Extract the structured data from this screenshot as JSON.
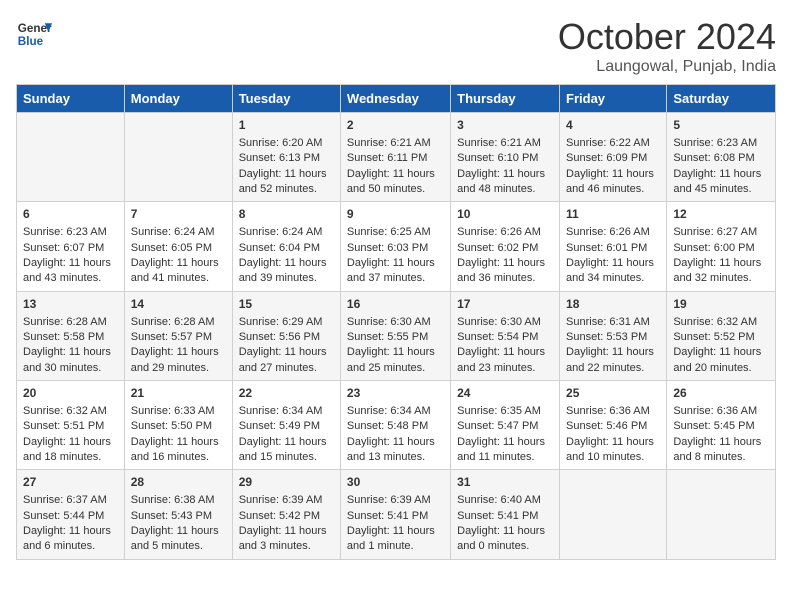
{
  "header": {
    "logo_line1": "General",
    "logo_line2": "Blue",
    "month": "October 2024",
    "location": "Laungowal, Punjab, India"
  },
  "days_of_week": [
    "Sunday",
    "Monday",
    "Tuesday",
    "Wednesday",
    "Thursday",
    "Friday",
    "Saturday"
  ],
  "weeks": [
    [
      {
        "day": "",
        "sunrise": "",
        "sunset": "",
        "daylight": ""
      },
      {
        "day": "",
        "sunrise": "",
        "sunset": "",
        "daylight": ""
      },
      {
        "day": "1",
        "sunrise": "Sunrise: 6:20 AM",
        "sunset": "Sunset: 6:13 PM",
        "daylight": "Daylight: 11 hours and 52 minutes."
      },
      {
        "day": "2",
        "sunrise": "Sunrise: 6:21 AM",
        "sunset": "Sunset: 6:11 PM",
        "daylight": "Daylight: 11 hours and 50 minutes."
      },
      {
        "day": "3",
        "sunrise": "Sunrise: 6:21 AM",
        "sunset": "Sunset: 6:10 PM",
        "daylight": "Daylight: 11 hours and 48 minutes."
      },
      {
        "day": "4",
        "sunrise": "Sunrise: 6:22 AM",
        "sunset": "Sunset: 6:09 PM",
        "daylight": "Daylight: 11 hours and 46 minutes."
      },
      {
        "day": "5",
        "sunrise": "Sunrise: 6:23 AM",
        "sunset": "Sunset: 6:08 PM",
        "daylight": "Daylight: 11 hours and 45 minutes."
      }
    ],
    [
      {
        "day": "6",
        "sunrise": "Sunrise: 6:23 AM",
        "sunset": "Sunset: 6:07 PM",
        "daylight": "Daylight: 11 hours and 43 minutes."
      },
      {
        "day": "7",
        "sunrise": "Sunrise: 6:24 AM",
        "sunset": "Sunset: 6:05 PM",
        "daylight": "Daylight: 11 hours and 41 minutes."
      },
      {
        "day": "8",
        "sunrise": "Sunrise: 6:24 AM",
        "sunset": "Sunset: 6:04 PM",
        "daylight": "Daylight: 11 hours and 39 minutes."
      },
      {
        "day": "9",
        "sunrise": "Sunrise: 6:25 AM",
        "sunset": "Sunset: 6:03 PM",
        "daylight": "Daylight: 11 hours and 37 minutes."
      },
      {
        "day": "10",
        "sunrise": "Sunrise: 6:26 AM",
        "sunset": "Sunset: 6:02 PM",
        "daylight": "Daylight: 11 hours and 36 minutes."
      },
      {
        "day": "11",
        "sunrise": "Sunrise: 6:26 AM",
        "sunset": "Sunset: 6:01 PM",
        "daylight": "Daylight: 11 hours and 34 minutes."
      },
      {
        "day": "12",
        "sunrise": "Sunrise: 6:27 AM",
        "sunset": "Sunset: 6:00 PM",
        "daylight": "Daylight: 11 hours and 32 minutes."
      }
    ],
    [
      {
        "day": "13",
        "sunrise": "Sunrise: 6:28 AM",
        "sunset": "Sunset: 5:58 PM",
        "daylight": "Daylight: 11 hours and 30 minutes."
      },
      {
        "day": "14",
        "sunrise": "Sunrise: 6:28 AM",
        "sunset": "Sunset: 5:57 PM",
        "daylight": "Daylight: 11 hours and 29 minutes."
      },
      {
        "day": "15",
        "sunrise": "Sunrise: 6:29 AM",
        "sunset": "Sunset: 5:56 PM",
        "daylight": "Daylight: 11 hours and 27 minutes."
      },
      {
        "day": "16",
        "sunrise": "Sunrise: 6:30 AM",
        "sunset": "Sunset: 5:55 PM",
        "daylight": "Daylight: 11 hours and 25 minutes."
      },
      {
        "day": "17",
        "sunrise": "Sunrise: 6:30 AM",
        "sunset": "Sunset: 5:54 PM",
        "daylight": "Daylight: 11 hours and 23 minutes."
      },
      {
        "day": "18",
        "sunrise": "Sunrise: 6:31 AM",
        "sunset": "Sunset: 5:53 PM",
        "daylight": "Daylight: 11 hours and 22 minutes."
      },
      {
        "day": "19",
        "sunrise": "Sunrise: 6:32 AM",
        "sunset": "Sunset: 5:52 PM",
        "daylight": "Daylight: 11 hours and 20 minutes."
      }
    ],
    [
      {
        "day": "20",
        "sunrise": "Sunrise: 6:32 AM",
        "sunset": "Sunset: 5:51 PM",
        "daylight": "Daylight: 11 hours and 18 minutes."
      },
      {
        "day": "21",
        "sunrise": "Sunrise: 6:33 AM",
        "sunset": "Sunset: 5:50 PM",
        "daylight": "Daylight: 11 hours and 16 minutes."
      },
      {
        "day": "22",
        "sunrise": "Sunrise: 6:34 AM",
        "sunset": "Sunset: 5:49 PM",
        "daylight": "Daylight: 11 hours and 15 minutes."
      },
      {
        "day": "23",
        "sunrise": "Sunrise: 6:34 AM",
        "sunset": "Sunset: 5:48 PM",
        "daylight": "Daylight: 11 hours and 13 minutes."
      },
      {
        "day": "24",
        "sunrise": "Sunrise: 6:35 AM",
        "sunset": "Sunset: 5:47 PM",
        "daylight": "Daylight: 11 hours and 11 minutes."
      },
      {
        "day": "25",
        "sunrise": "Sunrise: 6:36 AM",
        "sunset": "Sunset: 5:46 PM",
        "daylight": "Daylight: 11 hours and 10 minutes."
      },
      {
        "day": "26",
        "sunrise": "Sunrise: 6:36 AM",
        "sunset": "Sunset: 5:45 PM",
        "daylight": "Daylight: 11 hours and 8 minutes."
      }
    ],
    [
      {
        "day": "27",
        "sunrise": "Sunrise: 6:37 AM",
        "sunset": "Sunset: 5:44 PM",
        "daylight": "Daylight: 11 hours and 6 minutes."
      },
      {
        "day": "28",
        "sunrise": "Sunrise: 6:38 AM",
        "sunset": "Sunset: 5:43 PM",
        "daylight": "Daylight: 11 hours and 5 minutes."
      },
      {
        "day": "29",
        "sunrise": "Sunrise: 6:39 AM",
        "sunset": "Sunset: 5:42 PM",
        "daylight": "Daylight: 11 hours and 3 minutes."
      },
      {
        "day": "30",
        "sunrise": "Sunrise: 6:39 AM",
        "sunset": "Sunset: 5:41 PM",
        "daylight": "Daylight: 11 hours and 1 minute."
      },
      {
        "day": "31",
        "sunrise": "Sunrise: 6:40 AM",
        "sunset": "Sunset: 5:41 PM",
        "daylight": "Daylight: 11 hours and 0 minutes."
      },
      {
        "day": "",
        "sunrise": "",
        "sunset": "",
        "daylight": ""
      },
      {
        "day": "",
        "sunrise": "",
        "sunset": "",
        "daylight": ""
      }
    ]
  ]
}
